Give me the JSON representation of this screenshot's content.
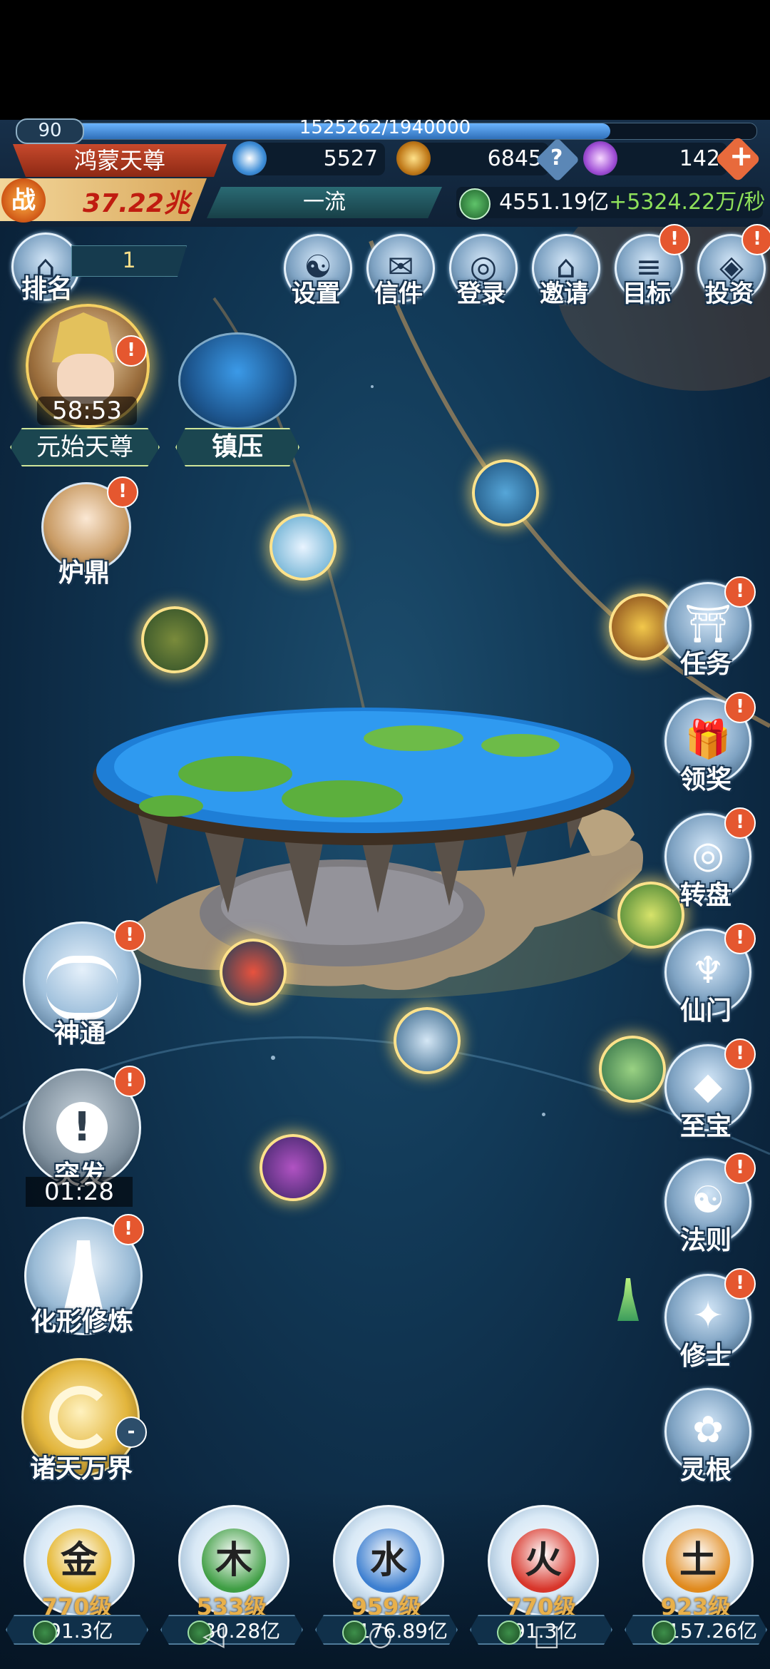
{
  "player": {
    "level": "90",
    "xp_text": "1525262/1940000",
    "xp_progress": 0.786,
    "title": "鸿蒙天尊",
    "power_prefix": "战",
    "power": "37.22兆",
    "rank_tier": "一流"
  },
  "resources": {
    "r1": "5527",
    "r2": "6845",
    "r3": "142",
    "income": "4551.19亿",
    "income_rate": "+5324.22万/秒"
  },
  "top_menu": [
    {
      "label": "设置",
      "icon": "settings-icon",
      "badge": ""
    },
    {
      "label": "信件",
      "icon": "mail-icon",
      "badge": ""
    },
    {
      "label": "登录",
      "icon": "login-icon",
      "badge": ""
    },
    {
      "label": "邀请",
      "icon": "invite-icon",
      "badge": ""
    },
    {
      "label": "目标",
      "icon": "goal-icon",
      "badge": "!"
    },
    {
      "label": "投资",
      "icon": "invest-icon",
      "badge": "!"
    }
  ],
  "rank": {
    "label": "排名",
    "value": "1"
  },
  "left_top": {
    "boss_label": "元始天尊",
    "boss_timer": "58:53",
    "boss_badge": "!",
    "suppress_label": "镇压",
    "furnace_label": "炉鼎",
    "furnace_badge": "!"
  },
  "left_menu": [
    {
      "label": "神通",
      "badge": "!"
    },
    {
      "label": "突发",
      "badge": "!",
      "timer": "01:28"
    },
    {
      "label": "化形修炼",
      "badge": "!"
    },
    {
      "label": "诸天万界",
      "badge": "-"
    }
  ],
  "right_menu": [
    {
      "label": "任务",
      "badge": "!"
    },
    {
      "label": "领奖",
      "badge": "!"
    },
    {
      "label": "转盘",
      "badge": "!"
    },
    {
      "label": "仙门",
      "badge": "!"
    },
    {
      "label": "至宝",
      "badge": "!"
    },
    {
      "label": "法则",
      "badge": "!"
    },
    {
      "label": "修士",
      "badge": "!"
    },
    {
      "label": "灵根",
      "badge": ""
    }
  ],
  "elements": [
    {
      "glyph": "金",
      "level": "770级",
      "cost": "91.3亿",
      "color": "#e4b428"
    },
    {
      "glyph": "木",
      "level": "533级",
      "cost": "30.28亿",
      "color": "#3f9e44"
    },
    {
      "glyph": "水",
      "level": "959级",
      "cost": "176.89亿",
      "color": "#3d7fd0"
    },
    {
      "glyph": "火",
      "level": "770级",
      "cost": "91.3亿",
      "color": "#d8362b"
    },
    {
      "glyph": "土",
      "level": "923级",
      "cost": "157.26亿",
      "color": "#e08a1e"
    }
  ],
  "colors": {
    "accent": "#e5572f",
    "gold": "#e8b04a",
    "plus": "#8ee05a"
  }
}
